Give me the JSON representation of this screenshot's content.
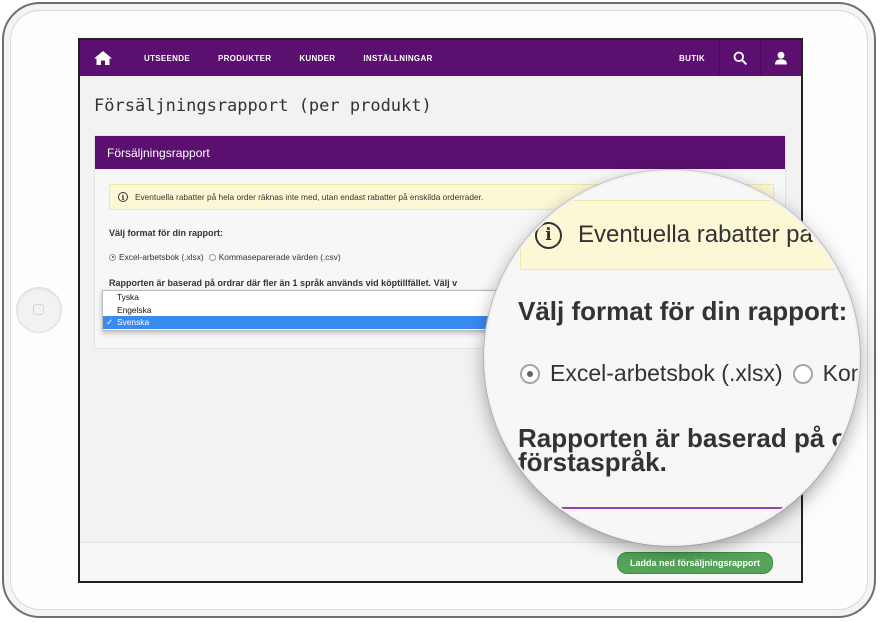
{
  "nav": {
    "items": [
      "UTSEENDE",
      "PRODUKTER",
      "KUNDER",
      "INSTÄLLNINGAR"
    ],
    "shop": "BUTIK"
  },
  "page": {
    "title": "Försäljningsrapport (per produkt)"
  },
  "panel": {
    "title": "Försäljningsrapport",
    "notice": "Eventuella rabatter på hela order räknas inte med, utan endast rabatter på enskilda orderrader.",
    "format_label": "Välj format för din rapport:",
    "format_options": [
      "Excel-arbetsbok (.xlsx)",
      "Kommaseparerade värden (.csv)"
    ],
    "selected_format": "Excel-arbetsbok (.xlsx)",
    "language_text": "Rapporten är baserad på ordrar där fler än 1 språk används vid köptillfället. Välj v",
    "language_options": [
      "Tyska",
      "Engelska",
      "Svenska"
    ],
    "selected_language": "Svenska",
    "selected_check": "✓"
  },
  "footer": {
    "download_label": "Ladda ned försäljningsrapport"
  },
  "magnifier": {
    "notice": "Eventuella rabatter på",
    "format_label": "Välj format för din rapport:",
    "option_1": "Excel-arbetsbok (.xlsx)",
    "option_2": "Kon",
    "report_line_1": "Rapporten är baserad på or",
    "report_line_2": "förstaspråk."
  },
  "colors": {
    "brand": "#5b0f6e",
    "notice_bg": "#fcf8d6",
    "button": "#55a45a",
    "selection": "#3a8bf0"
  }
}
